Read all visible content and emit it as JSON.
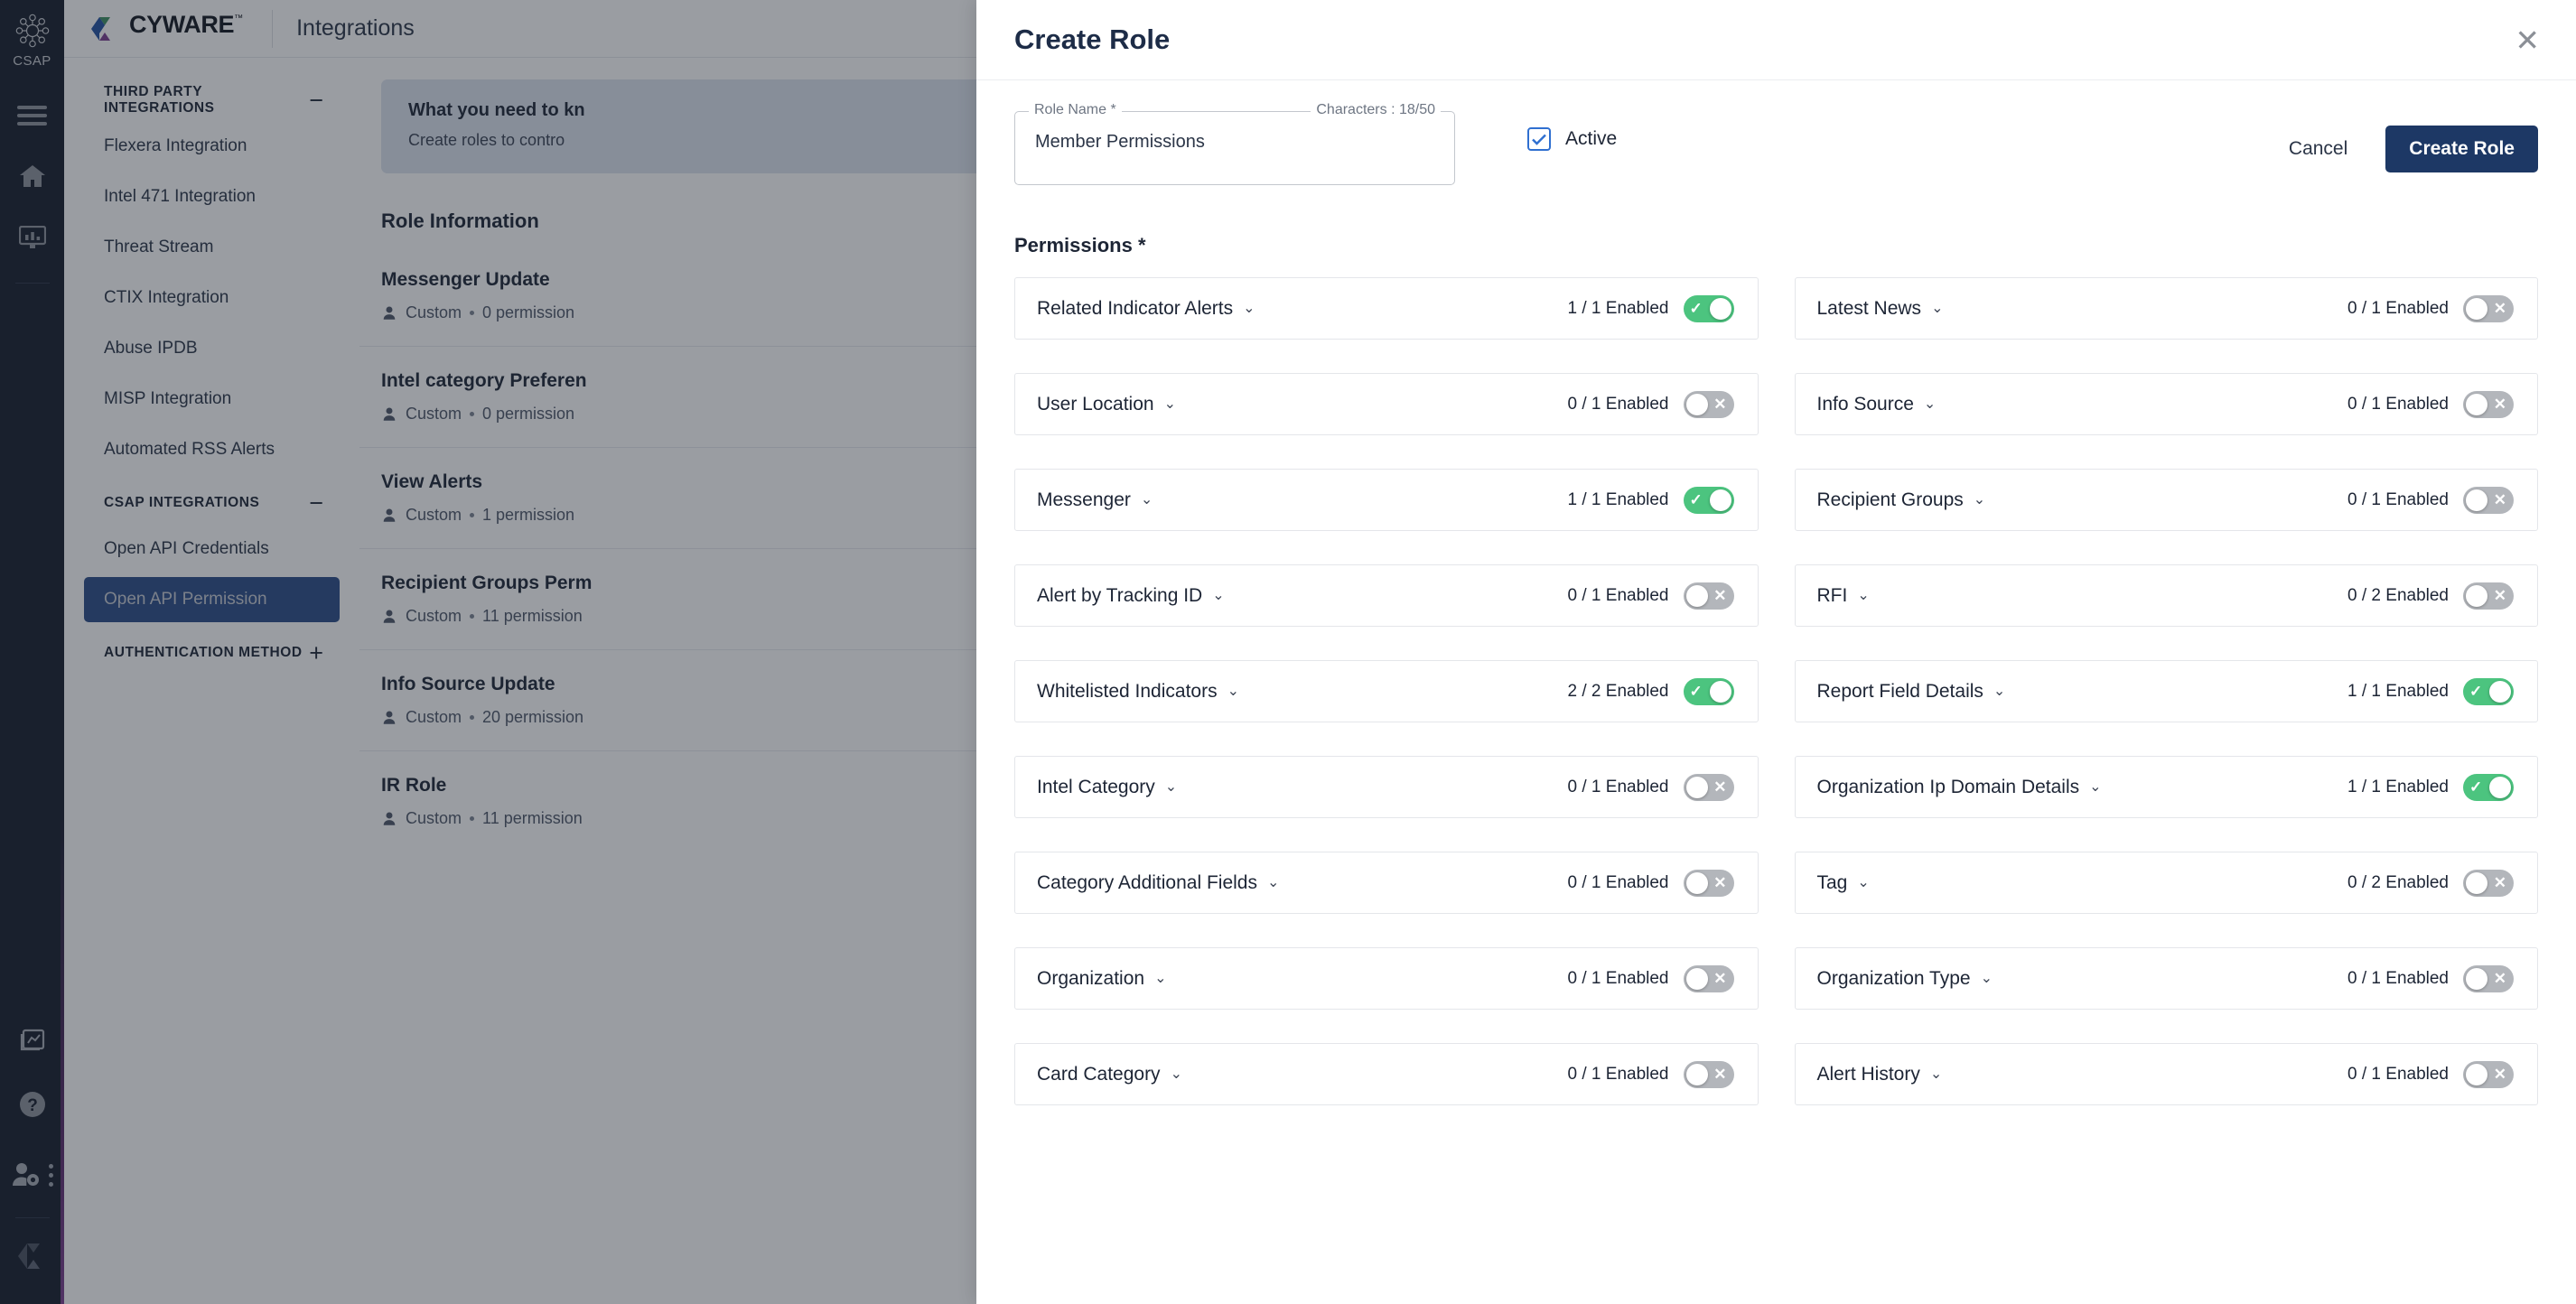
{
  "rail": {
    "logo_label": "CSAP",
    "icons": [
      "menu-icon",
      "home-icon",
      "dashboard-monitor-icon",
      "reports-icon",
      "help-icon",
      "user-settings-icon",
      "cyware-mark-icon"
    ]
  },
  "topbar": {
    "brand": "CYWARE",
    "brand_tm": "™",
    "title": "Integrations"
  },
  "sidebar": {
    "groups": [
      {
        "title": "THIRD PARTY INTEGRATIONS",
        "toggle": "−",
        "items": [
          {
            "label": "Flexera Integration",
            "selected": false
          },
          {
            "label": "Intel 471 Integration",
            "selected": false
          },
          {
            "label": "Threat Stream",
            "selected": false
          },
          {
            "label": "CTIX Integration",
            "selected": false
          },
          {
            "label": "Abuse IPDB",
            "selected": false
          },
          {
            "label": "MISP Integration",
            "selected": false
          },
          {
            "label": "Automated RSS Alerts",
            "selected": false
          }
        ]
      },
      {
        "title": "CSAP INTEGRATIONS",
        "toggle": "−",
        "items": [
          {
            "label": "Open API Credentials",
            "selected": false
          },
          {
            "label": "Open API Permission",
            "selected": true
          }
        ]
      },
      {
        "title": "AUTHENTICATION METHOD",
        "toggle": "+",
        "items": []
      }
    ]
  },
  "main": {
    "notice_title": "What you need to kn",
    "notice_body": "Create roles to contro",
    "section_title": "Role Information",
    "roles": [
      {
        "name": "Messenger Update",
        "type": "Custom",
        "permissions": "0 permission"
      },
      {
        "name": "Intel category Preferen",
        "type": "Custom",
        "permissions": "0 permission"
      },
      {
        "name": "View Alerts",
        "type": "Custom",
        "permissions": "1 permission"
      },
      {
        "name": "Recipient Groups Perm",
        "type": "Custom",
        "permissions": "11 permission"
      },
      {
        "name": "Info Source Update",
        "type": "Custom",
        "permissions": "20 permission"
      },
      {
        "name": "IR Role",
        "type": "Custom",
        "permissions": "11 permission"
      }
    ]
  },
  "modal": {
    "title": "Create Role",
    "close_icon": "✕",
    "role_name_label": "Role Name *",
    "role_name_value": "Member Permissions",
    "character_counter": "Characters : 18/50",
    "active_label": "Active",
    "active_checked": true,
    "cancel_label": "Cancel",
    "create_label": "Create Role",
    "permissions_title": "Permissions *",
    "colors": {
      "toggle_on": "#4cc47f",
      "toggle_off": "#b3b6bb",
      "primary_button": "#1d3865",
      "checkbox": "#2f6fd0"
    },
    "permissions": [
      {
        "label": "Related Indicator Alerts",
        "count": "1 / 1 Enabled",
        "on": true
      },
      {
        "label": "Latest News",
        "count": "0 / 1 Enabled",
        "on": false
      },
      {
        "label": "User Location",
        "count": "0 / 1 Enabled",
        "on": false
      },
      {
        "label": "Info Source",
        "count": "0 / 1 Enabled",
        "on": false
      },
      {
        "label": "Messenger",
        "count": "1 / 1 Enabled",
        "on": true
      },
      {
        "label": "Recipient Groups",
        "count": "0 / 1 Enabled",
        "on": false
      },
      {
        "label": "Alert by Tracking ID",
        "count": "0 / 1 Enabled",
        "on": false
      },
      {
        "label": "RFI",
        "count": "0 / 2 Enabled",
        "on": false
      },
      {
        "label": "Whitelisted Indicators",
        "count": "2 / 2 Enabled",
        "on": true
      },
      {
        "label": "Report Field Details",
        "count": "1 / 1 Enabled",
        "on": true
      },
      {
        "label": "Intel Category",
        "count": "0 / 1 Enabled",
        "on": false
      },
      {
        "label": "Organization Ip Domain Details",
        "count": "1 / 1 Enabled",
        "on": true
      },
      {
        "label": "Category Additional Fields",
        "count": "0 / 1 Enabled",
        "on": false
      },
      {
        "label": "Tag",
        "count": "0 / 2 Enabled",
        "on": false
      },
      {
        "label": "Organization",
        "count": "0 / 1 Enabled",
        "on": false
      },
      {
        "label": "Organization Type",
        "count": "0 / 1 Enabled",
        "on": false
      },
      {
        "label": "Card Category",
        "count": "0 / 1 Enabled",
        "on": false
      },
      {
        "label": "Alert History",
        "count": "0 / 1 Enabled",
        "on": false
      }
    ]
  }
}
